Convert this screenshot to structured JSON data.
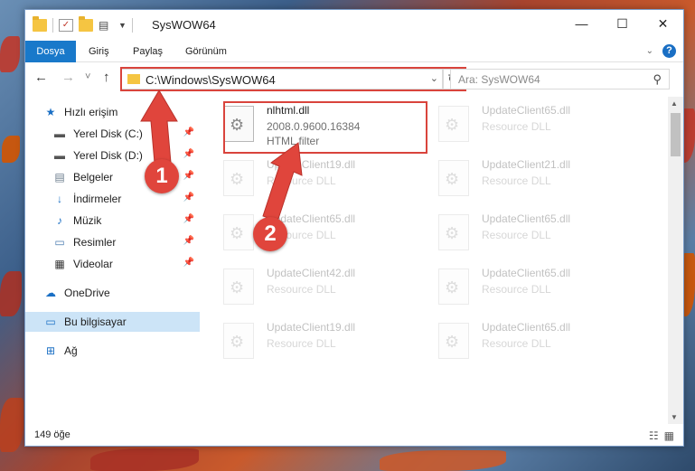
{
  "window": {
    "title": "SysWOW64",
    "controls": {
      "minimize": "—",
      "maximize": "☐",
      "close": "✕"
    }
  },
  "ribbon": {
    "tabs": [
      "Dosya",
      "Giriş",
      "Paylaş",
      "Görünüm"
    ],
    "expand_icon": "chevron-down-icon",
    "help_icon": "?"
  },
  "navbar": {
    "back": "←",
    "forward": "→",
    "recent": "˅",
    "up": "↑",
    "address": "C:\\Windows\\SysWOW64",
    "search_placeholder": "Ara: SysWOW64"
  },
  "sidebar": {
    "items": [
      {
        "label": "Hızlı erişim",
        "icon": "star-icon",
        "pinned": false
      },
      {
        "label": "Yerel Disk (C:)",
        "icon": "drive-icon",
        "pinned": true
      },
      {
        "label": "Yerel Disk (D:)",
        "icon": "drive-icon",
        "pinned": true
      },
      {
        "label": "Belgeler",
        "icon": "documents-icon",
        "pinned": true
      },
      {
        "label": "İndirmeler",
        "icon": "download-icon",
        "pinned": true
      },
      {
        "label": "Müzik",
        "icon": "music-icon",
        "pinned": true
      },
      {
        "label": "Resimler",
        "icon": "pictures-icon",
        "pinned": true
      },
      {
        "label": "Videolar",
        "icon": "video-icon",
        "pinned": true
      },
      {
        "label": "OneDrive",
        "icon": "cloud-icon",
        "pinned": false
      },
      {
        "label": "Bu bilgisayar",
        "icon": "computer-icon",
        "pinned": false,
        "selected": true
      },
      {
        "label": "Ağ",
        "icon": "network-icon",
        "pinned": false
      }
    ]
  },
  "files": [
    {
      "name": "nlhtml.dll",
      "version": "2008.0.9600.16384",
      "type": "HTML filter",
      "highlighted": true
    },
    {
      "name": "UpdateClient65.dll",
      "version": "Resource DLL",
      "type": "",
      "highlighted": false
    },
    {
      "name": "UpdateClient19.dll",
      "version": "Resource DLL",
      "type": "",
      "highlighted": false
    },
    {
      "name": "UpdateClient21.dll",
      "version": "Resource DLL",
      "type": "",
      "highlighted": false
    },
    {
      "name": "UpdateClient65.dll",
      "version": "Resource DLL",
      "type": "",
      "highlighted": false
    },
    {
      "name": "UpdateClient65.dll",
      "version": "Resource DLL",
      "type": "",
      "highlighted": false
    },
    {
      "name": "UpdateClient42.dll",
      "version": "Resource DLL",
      "type": "",
      "highlighted": false
    },
    {
      "name": "UpdateClient65.dll",
      "version": "Resource DLL",
      "type": "",
      "highlighted": false
    },
    {
      "name": "UpdateClient19.dll",
      "version": "Resource DLL",
      "type": "",
      "highlighted": false
    },
    {
      "name": "UpdateClient65.dll",
      "version": "Resource DLL",
      "type": "",
      "highlighted": false
    }
  ],
  "status": {
    "count": "149 öğe"
  },
  "callouts": [
    {
      "number": "1"
    },
    {
      "number": "2"
    }
  ],
  "colors": {
    "accent": "#1979ca",
    "highlight_box": "#d9443c",
    "callout": "#e0453c",
    "selected": "#cce4f7"
  }
}
